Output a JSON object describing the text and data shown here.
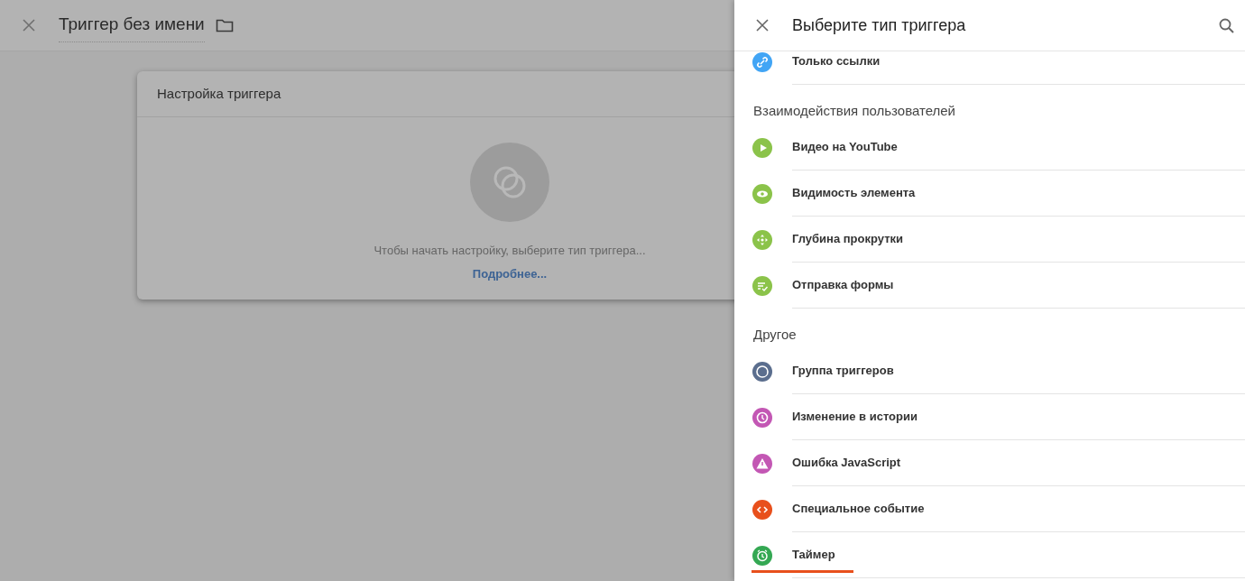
{
  "editor": {
    "title": "Триггер без имени"
  },
  "card": {
    "title": "Настройка триггера",
    "hint": "Чтобы начать настройку, выберите тип триггера...",
    "link": "Подробнее..."
  },
  "panel": {
    "title": "Выберите тип триггера",
    "sections": [
      {
        "items": [
          {
            "label": "Только ссылки",
            "kind": "link",
            "color": "#42a5f5",
            "underlined": false
          }
        ]
      },
      {
        "heading": "Взаимодействия пользователей",
        "items": [
          {
            "label": "Видео на YouTube",
            "kind": "play",
            "color": "#8bc34a",
            "underlined": false
          },
          {
            "label": "Видимость элемента",
            "kind": "eye",
            "color": "#8bc34a",
            "underlined": false
          },
          {
            "label": "Глубина прокрутки",
            "kind": "scroll",
            "color": "#8bc34a",
            "underlined": false
          },
          {
            "label": "Отправка формы",
            "kind": "form",
            "color": "#8bc34a",
            "underlined": false
          }
        ]
      },
      {
        "heading": "Другое",
        "items": [
          {
            "label": "Группа триггеров",
            "kind": "group",
            "color": "#5b6e8e",
            "underlined": false
          },
          {
            "label": "Изменение в истории",
            "kind": "history",
            "color": "#c357b4",
            "underlined": false
          },
          {
            "label": "Ошибка JavaScript",
            "kind": "warning",
            "color": "#c357b4",
            "underlined": false
          },
          {
            "label": "Специальное событие",
            "kind": "code",
            "color": "#e8501c",
            "underlined": false
          },
          {
            "label": "Таймер",
            "kind": "timer",
            "color": "#34a853",
            "underlined": true
          }
        ]
      }
    ]
  }
}
